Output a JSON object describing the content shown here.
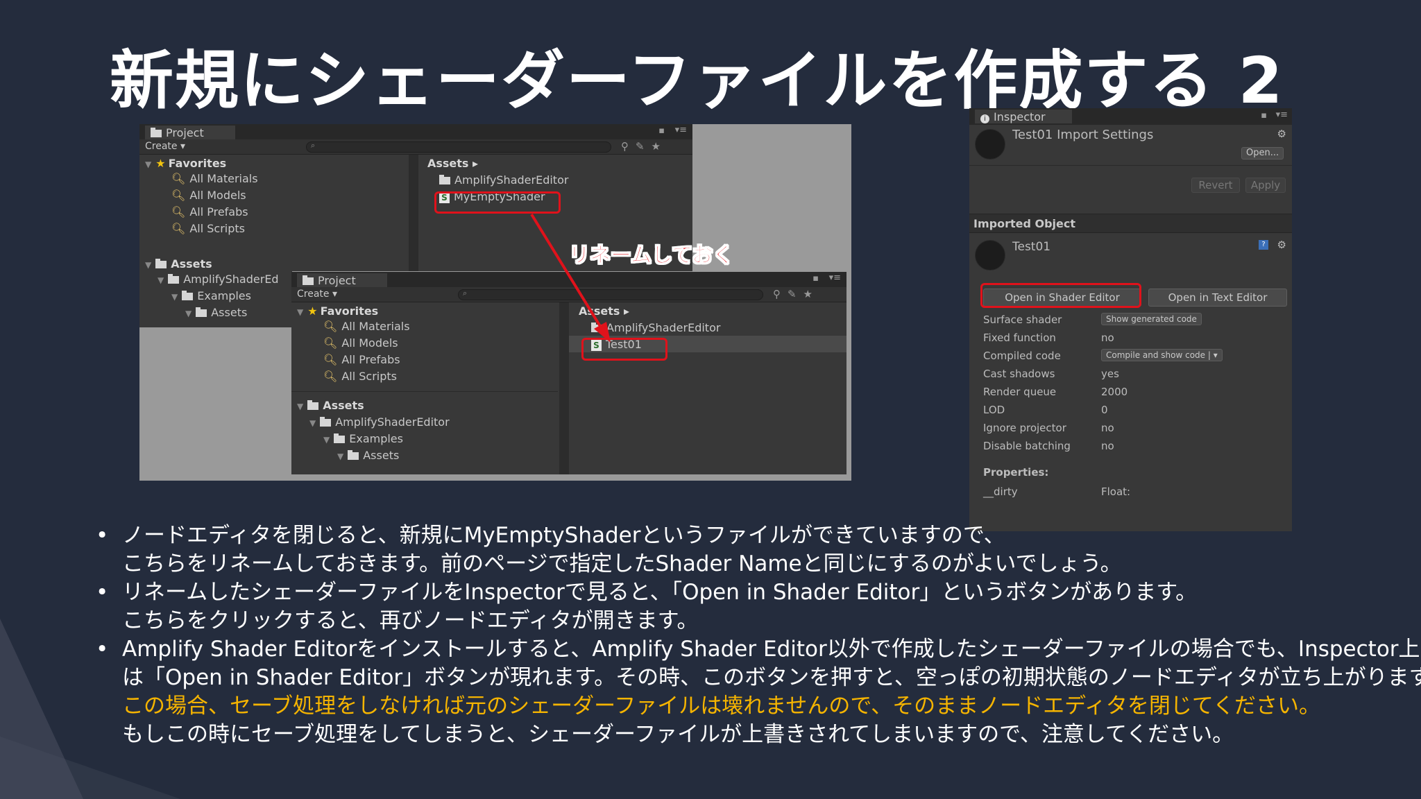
{
  "title": "新規にシェーダーファイルを作成する 2",
  "project_panel": {
    "tab": "Project",
    "create": "Create ▾",
    "favorites": {
      "header": "Favorites",
      "items": [
        "All Materials",
        "All Models",
        "All Prefabs",
        "All Scripts"
      ]
    },
    "assets_tree": {
      "header": "Assets",
      "items": [
        "AmplifyShaderEd",
        "Examples",
        "Assets"
      ]
    },
    "breadcrumb": "Assets ▸",
    "files": [
      "AmplifyShaderEditor",
      "MyEmptyShader"
    ]
  },
  "project_panel_2": {
    "tab": "Project",
    "create": "Create ▾",
    "favorites": {
      "header": "Favorites",
      "items": [
        "All Materials",
        "All Models",
        "All Prefabs",
        "All Scripts"
      ]
    },
    "assets_tree": {
      "header": "Assets",
      "items": [
        "AmplifyShaderEditor",
        "Examples",
        "Assets"
      ]
    },
    "breadcrumb": "Assets ▸",
    "files": [
      "AmplifyShaderEditor",
      "Test01"
    ]
  },
  "annotation": "リネームしておく",
  "inspector": {
    "tab": "Inspector",
    "import_title": "Test01 Import Settings",
    "open_btn": "Open...",
    "revert_btn": "Revert",
    "apply_btn": "Apply",
    "imported_object_header": "Imported Object",
    "object_name": "Test01",
    "open_shader_editor": "Open in Shader Editor",
    "open_text_editor": "Open in Text Editor",
    "rows": [
      {
        "label": "Surface shader",
        "value": "Show generated code"
      },
      {
        "label": "Fixed function",
        "value": "no"
      },
      {
        "label": "Compiled code",
        "value": "Compile and show code | ▾"
      },
      {
        "label": "Cast shadows",
        "value": "yes"
      },
      {
        "label": "Render queue",
        "value": "2000"
      },
      {
        "label": "LOD",
        "value": "0"
      },
      {
        "label": "Ignore projector",
        "value": "no"
      },
      {
        "label": "Disable batching",
        "value": "no"
      }
    ],
    "properties_header": "Properties:",
    "prop_name": "__dirty",
    "prop_value": "Float:"
  },
  "bullets": [
    [
      "ノードエディタを閉じると、新規にMyEmptyShaderというファイルができていますので、",
      "こちらをリネームしておきます。前のページで指定したShader Nameと同じにするのがよいでしょう。"
    ],
    [
      "リネームしたシェーダーファイルをInspectorで見ると、「Open in Shader Editor」というボタンがあります。",
      "こちらをクリックすると、再びノードエディタが開きます。"
    ],
    [
      "Amplify Shader Editorをインストールすると、Amplify Shader Editor以外で作成したシェーダーファイルの場合でも、Inspector上で",
      "は「Open in Shader Editor」ボタンが現れます。その時、このボタンを押すと、空っぽの初期状態のノードエディタが立ち上がります。",
      "この場合、セーブ処理をしなければ元のシェーダーファイルは壊れませんので、そのままノードエディタを閉じてください。",
      "もしこの時にセーブ処理をしてしまうと、シェーダーファイルが上書きされてしまいますので、注意してください。"
    ]
  ],
  "bullet_char": "•",
  "colors": {
    "background": "#242c3d",
    "highlight": "#e0121b",
    "warning_text": "#f5b400"
  }
}
